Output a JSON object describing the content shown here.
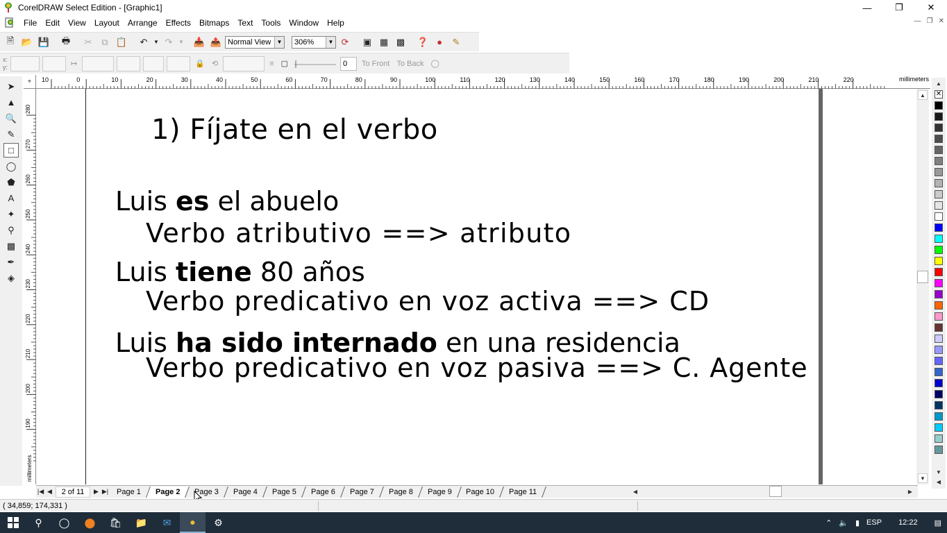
{
  "window": {
    "title": "CorelDRAW Select Edition - [Graphic1]",
    "controls": [
      "—",
      "❐",
      "✕"
    ]
  },
  "menu": [
    "File",
    "Edit",
    "View",
    "Layout",
    "Arrange",
    "Effects",
    "Bitmaps",
    "Text",
    "Tools",
    "Window",
    "Help"
  ],
  "toolbar": {
    "view_mode": "Normal View",
    "zoom": "306%"
  },
  "property_bar": {
    "x_label": "x:",
    "y_label": "y:",
    "rotation_value": "0",
    "to_front": "To Front",
    "to_back": "To Back"
  },
  "ruler": {
    "units": "millimeters",
    "h_ticks": [
      "10",
      "0",
      "10",
      "20",
      "30",
      "40",
      "50",
      "60",
      "70",
      "80",
      "90",
      "100",
      "110",
      "120",
      "130",
      "140",
      "150",
      "160",
      "170",
      "180",
      "190",
      "200",
      "210",
      "220"
    ],
    "v_ticks": [
      "280",
      "270",
      "260",
      "250",
      "240",
      "230",
      "220",
      "210",
      "200",
      "190"
    ],
    "v_units": "millimeters"
  },
  "slide": {
    "heading": "1) Fíjate en el verbo",
    "line1_a": "Luis ",
    "line1_b": "es",
    "line1_c": " el abuelo",
    "line2": "Verbo atributivo ==> atributo",
    "line3_a": "Luis ",
    "line3_b": "tiene",
    "line3_c": " 80 años",
    "line4": "Verbo predicativo en voz activa ==> CD",
    "line5_a": "Luis ",
    "line5_b": "ha sido internado",
    "line5_c": " en una residencia",
    "line6": "Verbo predicativo en voz pasiva ==> C. Agente"
  },
  "pages": {
    "count_label": "2 of 11",
    "tabs": [
      "Page 1",
      "Page 2",
      "Page 3",
      "Page 4",
      "Page 5",
      "Page 6",
      "Page 7",
      "Page 8",
      "Page 9",
      "Page 10",
      "Page 11"
    ],
    "active": "Page 2"
  },
  "status": {
    "coords": "( 34,859; 174,331 )"
  },
  "palette": [
    "#000000",
    "#1a1a1a",
    "#333333",
    "#4d4d4d",
    "#666666",
    "#808080",
    "#999999",
    "#b3b3b3",
    "#cccccc",
    "#e6e6e6",
    "#ffffff",
    "#0000ff",
    "#00ffff",
    "#00ff00",
    "#ffff00",
    "#ff0000",
    "#ff00ff",
    "#9900cc",
    "#ff6600",
    "#ff99cc",
    "#663333",
    "#ccccff",
    "#9999ff",
    "#6666ff",
    "#3366cc",
    "#0000cc",
    "#000066",
    "#003366",
    "#0099cc",
    "#00ccff",
    "#99cccc",
    "#669999"
  ],
  "taskbar": {
    "language": "ESP",
    "time": "12:22"
  }
}
